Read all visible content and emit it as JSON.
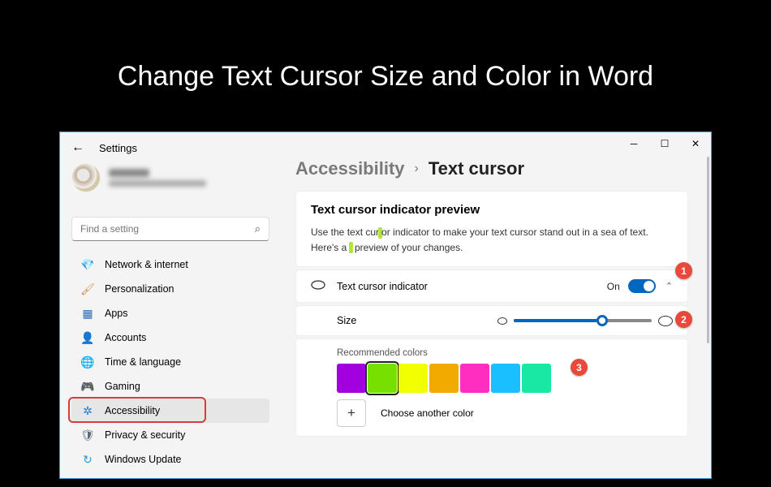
{
  "slide_title": "Change Text Cursor Size and Color in Word",
  "window": {
    "header_label": "Settings",
    "search_placeholder": "Find a setting"
  },
  "nav": [
    {
      "icon": "💎",
      "color": "#3aa0e8",
      "label": "Network & internet"
    },
    {
      "icon": "🖌",
      "color": "#d38a4a",
      "label": "Personalization"
    },
    {
      "icon": "▦",
      "color": "#2f6db0",
      "label": "Apps"
    },
    {
      "icon": "👤",
      "color": "#2aa06e",
      "label": "Accounts"
    },
    {
      "icon": "🌐",
      "color": "#2f88c9",
      "label": "Time & language"
    },
    {
      "icon": "🎮",
      "color": "#5a6a78",
      "label": "Gaming"
    },
    {
      "icon": "✲",
      "color": "#1e7bd6",
      "label": "Accessibility"
    },
    {
      "icon": "🛡",
      "color": "#5a6a78",
      "label": "Privacy & security"
    },
    {
      "icon": "↻",
      "color": "#1e9bd6",
      "label": "Windows Update"
    }
  ],
  "nav_active_index": 6,
  "breadcrumb": {
    "parent": "Accessibility",
    "sep": "›",
    "current": "Text cursor"
  },
  "preview": {
    "heading": "Text cursor indicator preview",
    "body_a": "Use the text cur",
    "body_b": "or indicator to make your text cursor stand out in a sea of text. Here's a",
    "body_c": "preview of your changes."
  },
  "indicator": {
    "label": "Text cursor indicator",
    "state": "On"
  },
  "size": {
    "label": "Size",
    "percent": 63
  },
  "colors": {
    "label": "Recommended colors",
    "swatches": [
      "#a300e0",
      "#78e000",
      "#f2ff00",
      "#f2a900",
      "#ff2ec1",
      "#1abfff",
      "#18e8a4"
    ],
    "selected_index": 1,
    "choose_label": "Choose another color"
  },
  "badges": {
    "b1": "1",
    "b2": "2",
    "b3": "3"
  }
}
